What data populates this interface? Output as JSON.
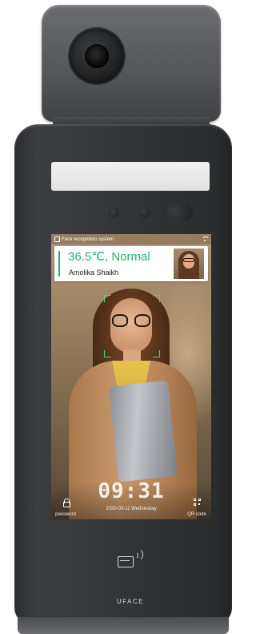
{
  "status_bar": {
    "app_title": "Face recognition system",
    "app_icon": "face-scan-icon",
    "network_icon": "wifi-icon"
  },
  "recognition_result": {
    "temperature_status": "36.5℃, Normal",
    "person_name": "Amolika Shaikh",
    "accent_color": "#1fb36a",
    "temperature_color": "#1fb36a"
  },
  "face_frame_color": "#37e36e",
  "clock": {
    "time": "09:31",
    "date": "2020-03-11 Wednesday"
  },
  "controls": {
    "password_label": "password",
    "qr_label": "QR code"
  },
  "device": {
    "brand": "UFACE",
    "card_reader_icon": "nfc-card-icon"
  }
}
